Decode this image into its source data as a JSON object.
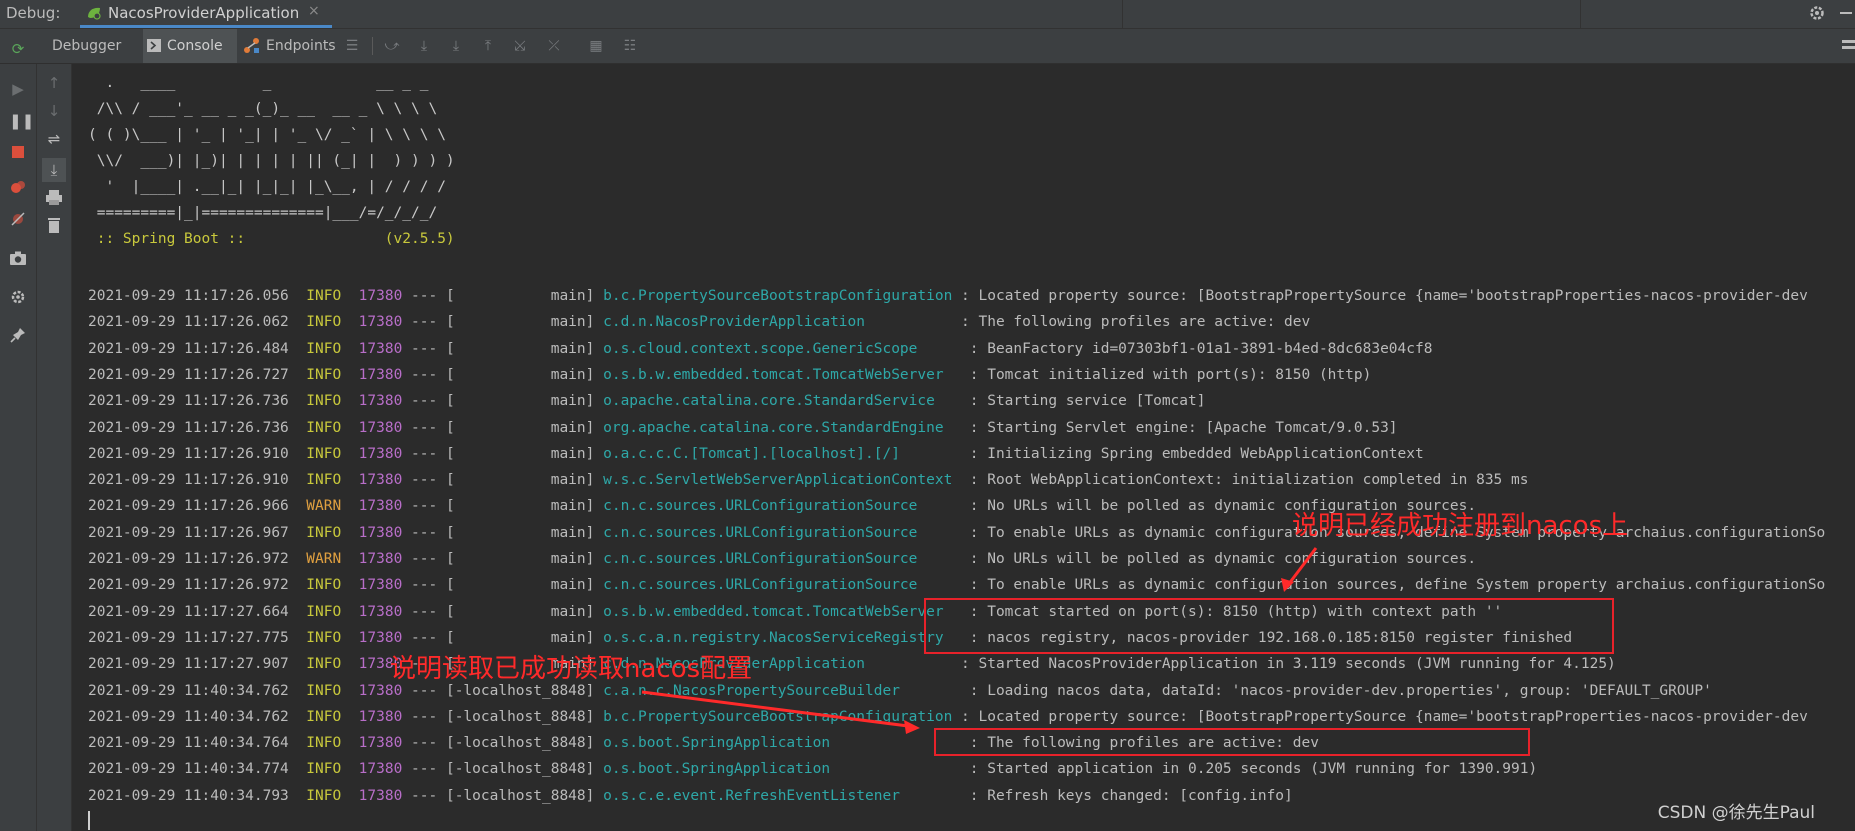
{
  "debug_bar": {
    "label": "Debug:",
    "tab_title": "NacosProviderApplication",
    "close_glyph": "×"
  },
  "toolbar": {
    "debugger_label": "Debugger",
    "console_label": "Console",
    "endpoints_label": "Endpoints"
  },
  "banner": [
    "  .   ____          _            __ _ _",
    " /\\\\ / ___'_ __ _ _(_)_ __  __ _ \\ \\ \\ \\",
    "( ( )\\___ | '_ | '_| | '_ \\/ _` | \\ \\ \\ \\",
    " \\\\/  ___)| |_)| | | | | || (_| |  ) ) ) )",
    "  '  |____| .__|_| |_|_| |_\\__, | / / / /",
    " =========|_|==============|___/=/_/_/_/",
    " :: Spring Boot ::                (v2.5.5)"
  ],
  "log_lines": [
    {
      "date": "2021-09-29 11:17:26.056",
      "level": "INFO",
      "pid": "17380",
      "thread": "[           main]",
      "logger": "b.c.PropertySourceBootstrapConfiguration",
      "msg": ": Located property source: [BootstrapPropertySource {name='bootstrapProperties-nacos-provider-dev"
    },
    {
      "date": "2021-09-29 11:17:26.062",
      "level": "INFO",
      "pid": "17380",
      "thread": "[           main]",
      "logger": "c.d.n.NacosProviderApplication          ",
      "msg": ": The following profiles are active: dev"
    },
    {
      "date": "2021-09-29 11:17:26.484",
      "level": "INFO",
      "pid": "17380",
      "thread": "[           main]",
      "logger": "o.s.cloud.context.scope.GenericScope     ",
      "msg": ": BeanFactory id=07303bf1-01a1-3891-b4ed-8dc683e04cf8"
    },
    {
      "date": "2021-09-29 11:17:26.727",
      "level": "INFO",
      "pid": "17380",
      "thread": "[           main]",
      "logger": "o.s.b.w.embedded.tomcat.TomcatWebServer  ",
      "msg": ": Tomcat initialized with port(s): 8150 (http)"
    },
    {
      "date": "2021-09-29 11:17:26.736",
      "level": "INFO",
      "pid": "17380",
      "thread": "[           main]",
      "logger": "o.apache.catalina.core.StandardService   ",
      "msg": ": Starting service [Tomcat]"
    },
    {
      "date": "2021-09-29 11:17:26.736",
      "level": "INFO",
      "pid": "17380",
      "thread": "[           main]",
      "logger": "org.apache.catalina.core.StandardEngine  ",
      "msg": ": Starting Servlet engine: [Apache Tomcat/9.0.53]"
    },
    {
      "date": "2021-09-29 11:17:26.910",
      "level": "INFO",
      "pid": "17380",
      "thread": "[           main]",
      "logger": "o.a.c.c.C.[Tomcat].[localhost].[/]       ",
      "msg": ": Initializing Spring embedded WebApplicationContext"
    },
    {
      "date": "2021-09-29 11:17:26.910",
      "level": "INFO",
      "pid": "17380",
      "thread": "[           main]",
      "logger": "w.s.c.ServletWebServerApplicationContext ",
      "msg": ": Root WebApplicationContext: initialization completed in 835 ms"
    },
    {
      "date": "2021-09-29 11:17:26.966",
      "level": "WARN",
      "pid": "17380",
      "thread": "[           main]",
      "logger": "c.n.c.sources.URLConfigurationSource     ",
      "msg": ": No URLs will be polled as dynamic configuration sources."
    },
    {
      "date": "2021-09-29 11:17:26.967",
      "level": "INFO",
      "pid": "17380",
      "thread": "[           main]",
      "logger": "c.n.c.sources.URLConfigurationSource     ",
      "msg": ": To enable URLs as dynamic configuration sources, define System property archaius.configurationSo"
    },
    {
      "date": "2021-09-29 11:17:26.972",
      "level": "WARN",
      "pid": "17380",
      "thread": "[           main]",
      "logger": "c.n.c.sources.URLConfigurationSource     ",
      "msg": ": No URLs will be polled as dynamic configuration sources."
    },
    {
      "date": "2021-09-29 11:17:26.972",
      "level": "INFO",
      "pid": "17380",
      "thread": "[           main]",
      "logger": "c.n.c.sources.URLConfigurationSource     ",
      "msg": ": To enable URLs as dynamic configuration sources, define System property archaius.configurationSo"
    },
    {
      "date": "2021-09-29 11:17:27.664",
      "level": "INFO",
      "pid": "17380",
      "thread": "[           main]",
      "logger": "o.s.b.w.embedded.tomcat.TomcatWebServer  ",
      "msg": ": Tomcat started on port(s): 8150 (http) with context path ''"
    },
    {
      "date": "2021-09-29 11:17:27.775",
      "level": "INFO",
      "pid": "17380",
      "thread": "[           main]",
      "logger": "o.s.c.a.n.registry.NacosServiceRegistry  ",
      "msg": ": nacos registry, nacos-provider 192.168.0.185:8150 register finished"
    },
    {
      "date": "2021-09-29 11:17:27.907",
      "level": "INFO",
      "pid": "17380",
      "thread": "[           main]",
      "logger": "c.d.n.NacosProviderApplication          ",
      "msg": ": Started NacosProviderApplication in 3.119 seconds (JVM running for 4.125)"
    },
    {
      "date": "2021-09-29 11:40:34.762",
      "level": "INFO",
      "pid": "17380",
      "thread": "[-localhost_8848]",
      "logger": "c.a.n.c.NacosPropertySourceBuilder       ",
      "msg": ": Loading nacos data, dataId: 'nacos-provider-dev.properties', group: 'DEFAULT_GROUP'"
    },
    {
      "date": "2021-09-29 11:40:34.762",
      "level": "INFO",
      "pid": "17380",
      "thread": "[-localhost_8848]",
      "logger": "b.c.PropertySourceBootstrapConfiguration",
      "msg": ": Located property source: [BootstrapPropertySource {name='bootstrapProperties-nacos-provider-dev"
    },
    {
      "date": "2021-09-29 11:40:34.764",
      "level": "INFO",
      "pid": "17380",
      "thread": "[-localhost_8848]",
      "logger": "o.s.boot.SpringApplication               ",
      "msg": ": The following profiles are active: dev"
    },
    {
      "date": "2021-09-29 11:40:34.774",
      "level": "INFO",
      "pid": "17380",
      "thread": "[-localhost_8848]",
      "logger": "o.s.boot.SpringApplication               ",
      "msg": ": Started application in 0.205 seconds (JVM running for 1390.991)"
    },
    {
      "date": "2021-09-29 11:40:34.793",
      "level": "INFO",
      "pid": "17380",
      "thread": "[-localhost_8848]",
      "logger": "o.s.c.e.event.RefreshEventListener       ",
      "msg": ": Refresh keys changed: [config.info]"
    }
  ],
  "annotations": {
    "registered": "说明已经成功注册到nacos上",
    "config_read": "说明读取已成功读取nacos配置"
  },
  "watermark": "CSDN @徐先生Paul",
  "colors": {
    "info": "#c8c83c",
    "warn": "#e0a040",
    "pid": "#b86ec8",
    "logger": "#2ea8a8",
    "highlight": "#e8222a",
    "annotation": "#ff2a2a"
  }
}
